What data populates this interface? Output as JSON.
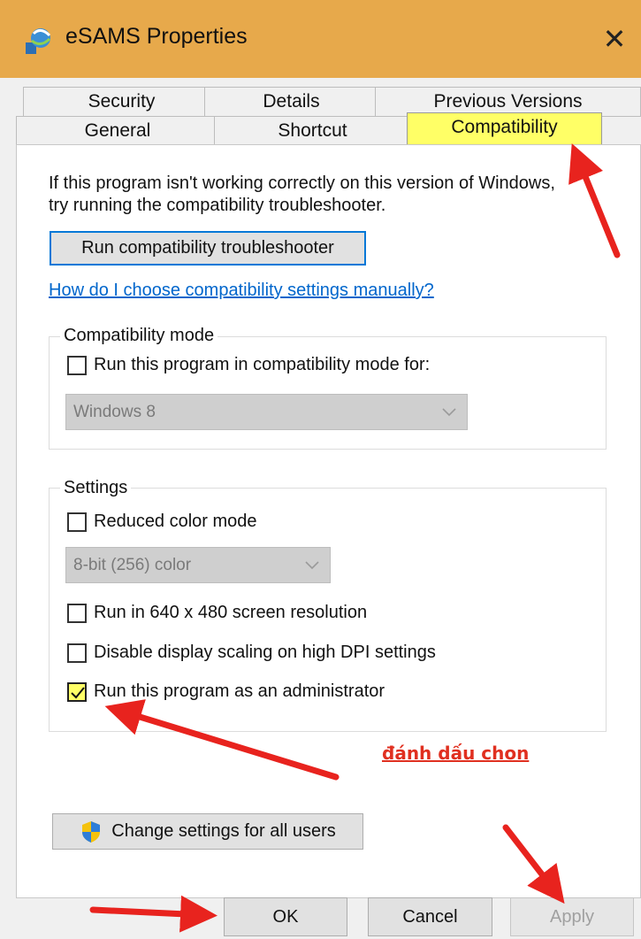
{
  "window": {
    "title": "eSAMS Properties",
    "close_glyph": "✕"
  },
  "tabs": {
    "back_row": [
      "Security",
      "Details",
      "Previous Versions"
    ],
    "front_row": [
      "General",
      "Shortcut",
      "Compatibility"
    ],
    "active": "Compatibility"
  },
  "intro": {
    "line1": "If this program isn't working correctly on this version of Windows,",
    "line2": "try running the compatibility troubleshooter."
  },
  "buttons": {
    "troubleshooter": "Run compatibility troubleshooter",
    "change_all_users": "Change settings for all users",
    "ok": "OK",
    "cancel": "Cancel",
    "apply": "Apply"
  },
  "link": "How do I choose compatibility settings manually?",
  "compat_mode": {
    "label": "Compatibility mode",
    "checkbox": {
      "label": "Run this program in compatibility mode for:",
      "checked": false
    },
    "select_value": "Windows 8"
  },
  "settings": {
    "label": "Settings",
    "reduced_color": {
      "label": "Reduced color mode",
      "checked": false
    },
    "color_select": "8-bit (256) color",
    "res640": {
      "label": "Run in 640 x 480 screen resolution",
      "checked": false
    },
    "dpi": {
      "label": "Disable display scaling on high DPI settings",
      "checked": false
    },
    "admin": {
      "label": "Run this program as an administrator",
      "checked": true
    }
  },
  "annotation": "đánh dấu chon",
  "colors": {
    "titlebar": "#e7a94b",
    "highlight": "#ffff66",
    "arrow": "#e8231e",
    "link": "#0066cc"
  },
  "icons": [
    "app-icon",
    "close-icon",
    "chevron-down-icon",
    "checkmark-icon",
    "uac-shield-icon"
  ]
}
